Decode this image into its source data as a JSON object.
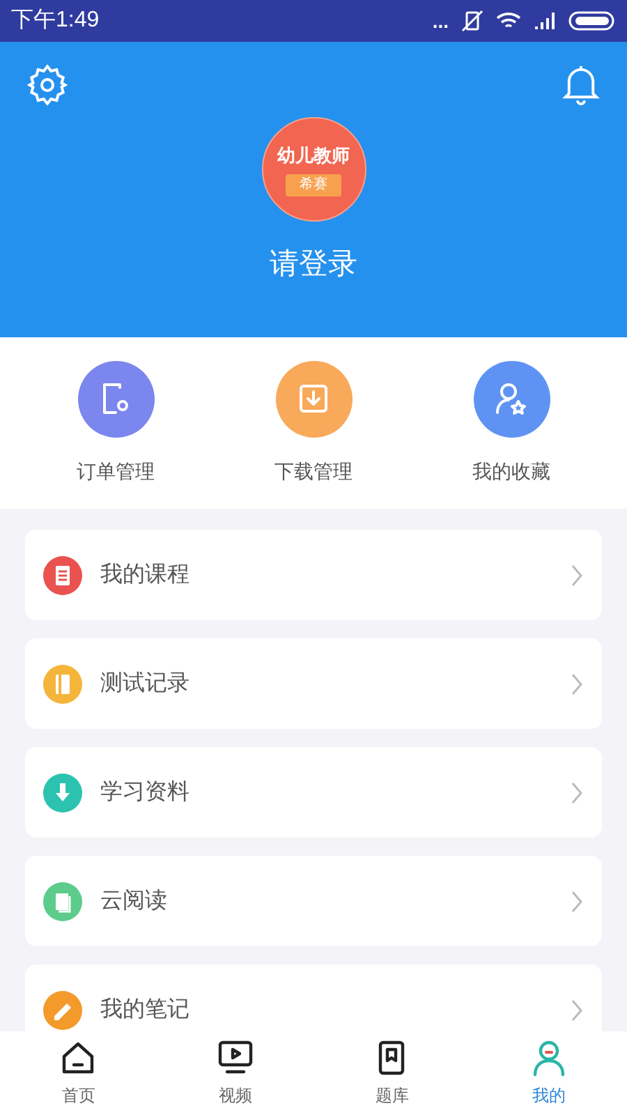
{
  "status_bar": {
    "time": "下午1:49",
    "dots": "..."
  },
  "profile": {
    "avatar_title": "幼儿教师",
    "avatar_badge": "希赛",
    "login": "请登录"
  },
  "shortcuts": [
    {
      "label": "订单管理",
      "kind": "order",
      "color": "#7b86ee"
    },
    {
      "label": "下载管理",
      "kind": "download",
      "color": "#f8a95a"
    },
    {
      "label": "我的收藏",
      "kind": "favorite",
      "color": "#5f93f3"
    }
  ],
  "menu": [
    {
      "label": "我的课程",
      "kind": "list",
      "color": "#e9524f"
    },
    {
      "label": "测试记录",
      "kind": "book",
      "color": "#f5b43a"
    },
    {
      "label": "学习资料",
      "kind": "download",
      "color": "#2bc3b0"
    },
    {
      "label": "云阅读",
      "kind": "page",
      "color": "#5dcb8a"
    },
    {
      "label": "我的笔记",
      "kind": "pencil",
      "color": "#f39a2b"
    }
  ],
  "nav": [
    {
      "label": "首页",
      "kind": "home",
      "selected": false
    },
    {
      "label": "视频",
      "kind": "video",
      "selected": false
    },
    {
      "label": "题库",
      "kind": "bank",
      "selected": false
    },
    {
      "label": "我的",
      "kind": "me",
      "selected": true
    }
  ]
}
